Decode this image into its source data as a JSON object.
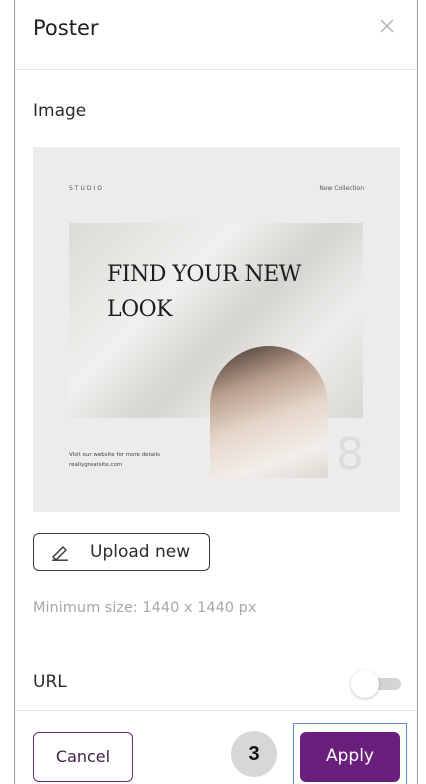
{
  "dialog": {
    "title": "Poster"
  },
  "image_section": {
    "label": "Image",
    "preview": {
      "brand": "STUDIO",
      "tag": "New Collection",
      "headline_line1": "FIND YOUR NEW",
      "headline_line2": "LOOK",
      "footer_line1": "Visit our website for more details",
      "footer_line2": "reallygreatsite.com",
      "numeral": "8"
    },
    "upload_label": "Upload new",
    "hint": "Minimum size: 1440 x 1440 px"
  },
  "url": {
    "label": "URL",
    "enabled": false
  },
  "footer": {
    "cancel_label": "Cancel",
    "step_badge": "3",
    "apply_label": "Apply"
  },
  "colors": {
    "accent": "#6a1f7d",
    "focus_outline": "#5a8fd6",
    "hint_text": "#a7a7a7"
  },
  "icons": {
    "close": "close-icon",
    "upload": "pencil-icon"
  }
}
